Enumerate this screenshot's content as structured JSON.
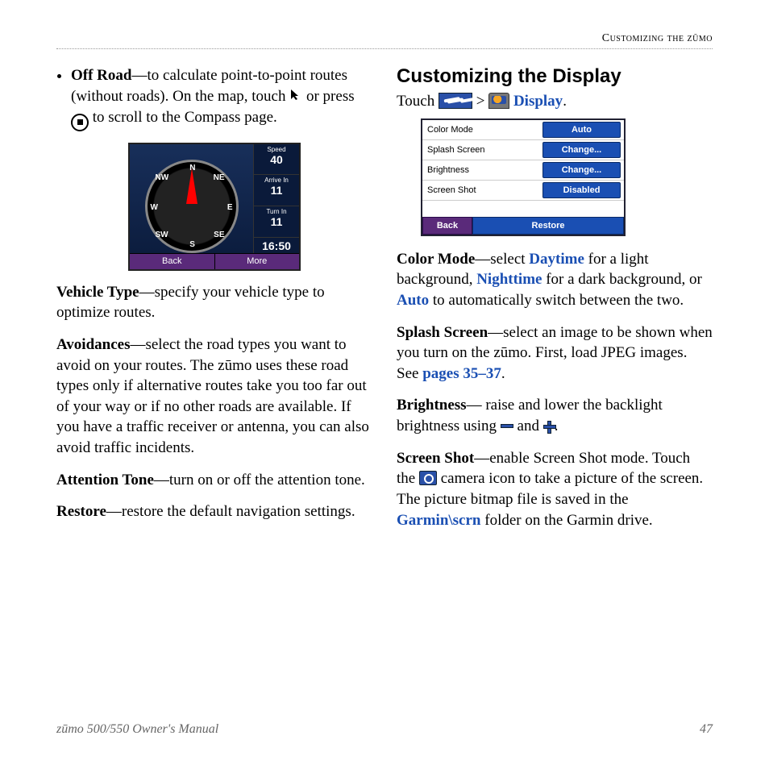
{
  "header": "Customizing the zūmo",
  "left": {
    "bullet_label": "Off Road",
    "bullet_text1": "—to calculate point-to-point routes (without roads). On the map, touch ",
    "bullet_text2": " or press ",
    "bullet_text3": " to scroll to the Compass page.",
    "compass": {
      "speed_label": "Speed",
      "speed": "40",
      "arrive_label": "Arrive In",
      "arrive": "11",
      "turn_label": "Turn In",
      "turn": "11",
      "time": "16:50",
      "back": "Back",
      "more": "More",
      "dirs": {
        "n": "N",
        "ne": "NE",
        "e": "E",
        "se": "SE",
        "s": "S",
        "sw": "SW",
        "w": "W",
        "nw": "NW"
      }
    },
    "vehicle_label": "Vehicle Type",
    "vehicle_text": "—specify your vehicle type to optimize routes.",
    "avoid_label": "Avoidances",
    "avoid_text": "—select the road types you want to avoid on your routes. The zūmo uses these road types only if alternative routes take you too far out of your way or if no other roads are available. If you have a traffic receiver or antenna, you can also avoid traffic incidents.",
    "tone_label": "Attention Tone",
    "tone_text": "—turn on or off the attention tone.",
    "restore_label": "Restore",
    "restore_text": "—restore the default navigation settings."
  },
  "right": {
    "heading": "Customizing the Display",
    "touch": "Touch ",
    "gt": " > ",
    "display_link": "Display",
    "period": ".",
    "settings": {
      "rows": [
        {
          "label": "Color Mode",
          "value": "Auto"
        },
        {
          "label": "Splash Screen",
          "value": "Change..."
        },
        {
          "label": "Brightness",
          "value": "Change..."
        },
        {
          "label": "Screen Shot",
          "value": "Disabled"
        }
      ],
      "back": "Back",
      "restore": "Restore"
    },
    "color_label": "Color Mode",
    "color_t1": "—select ",
    "color_day": "Daytime",
    "color_t2": " for a light background, ",
    "color_night": "Nighttime",
    "color_t3": " for a dark background, or ",
    "color_auto": "Auto",
    "color_t4": " to automatically switch between the two.",
    "splash_label": "Splash Screen",
    "splash_t1": "—select an image to be shown when you turn on the zūmo. First, load JPEG images. See ",
    "splash_link": "pages 35–37",
    "splash_t2": ".",
    "bright_label": "Brightness",
    "bright_t1": "— raise and lower the backlight brightness using ",
    "bright_and": " and ",
    "bright_end": ".",
    "shot_label": "Screen Shot",
    "shot_t1": "—enable Screen Shot mode. Touch the ",
    "shot_t2": " camera icon to take a picture of the screen. The picture bitmap file is saved in the ",
    "shot_path": "Garmin\\scrn",
    "shot_t3": " folder on the Garmin drive."
  },
  "footer": {
    "left": "zūmo 500/550 Owner's Manual",
    "right": "47"
  }
}
